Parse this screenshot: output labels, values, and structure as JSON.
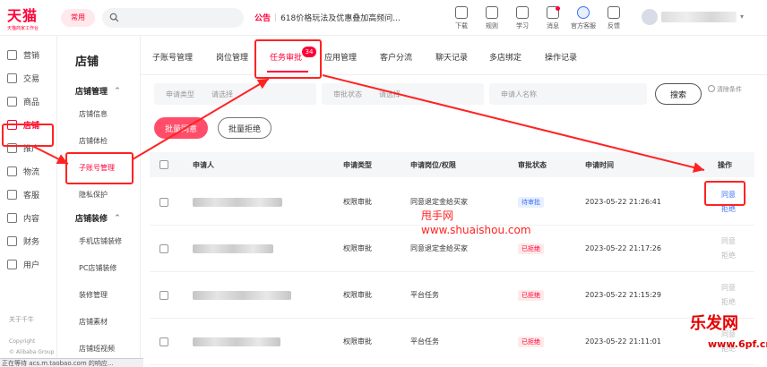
{
  "header": {
    "logo_main": "天猫",
    "logo_sub": "天猫商家工作台",
    "common_label": "常用",
    "notice_tag": "公告",
    "notice_text": "618价格玩法及优惠叠加高频问...",
    "icons": [
      {
        "label": "下载",
        "icon": "download-icon"
      },
      {
        "label": "规则",
        "icon": "rules-icon"
      },
      {
        "label": "学习",
        "icon": "learn-icon"
      },
      {
        "label": "消息",
        "icon": "message-icon",
        "dot": true
      },
      {
        "label": "官方客服",
        "icon": "service-icon"
      },
      {
        "label": "反馈",
        "icon": "feedback-icon"
      }
    ]
  },
  "leftnav": {
    "items": [
      {
        "label": "营销",
        "icon": "marketing-icon"
      },
      {
        "label": "交易",
        "icon": "trade-icon"
      },
      {
        "label": "商品",
        "icon": "goods-icon"
      },
      {
        "label": "店铺",
        "icon": "store-icon",
        "active": true
      },
      {
        "label": "推广",
        "icon": "promote-icon"
      },
      {
        "label": "物流",
        "icon": "logistics-icon"
      },
      {
        "label": "客服",
        "icon": "cs-icon"
      },
      {
        "label": "内容",
        "icon": "content-icon"
      },
      {
        "label": "财务",
        "icon": "finance-icon"
      },
      {
        "label": "用户",
        "icon": "user-icon"
      }
    ],
    "about": "关于千牛",
    "copyright": "Copyright",
    "copyright2": "© Alibaba Group"
  },
  "subnav": {
    "title": "店铺",
    "group1": "店铺管理",
    "group1_items": [
      "店铺信息",
      "店铺体检",
      "子账号管理",
      "隐私保护"
    ],
    "group2": "店铺装修",
    "group2_items": [
      "手机店铺装修",
      "PC店铺装修",
      "装修管理",
      "店铺素材",
      "店铺班视频"
    ]
  },
  "tabs": {
    "items": [
      "子账号管理",
      "岗位管理",
      "任务审批",
      "应用管理",
      "客户分流",
      "聊天记录",
      "多店绑定",
      "操作记录"
    ],
    "badge": "34"
  },
  "filters": {
    "type_label": "申请类型",
    "type_placeholder": "请选择",
    "status_label": "审批状态",
    "status_placeholder": "请选择",
    "applicant_placeholder": "申请人名称",
    "search": "搜索",
    "clear": "清除条件"
  },
  "actions": {
    "bulk_agree": "批量同意",
    "bulk_reject": "批量拒绝"
  },
  "table": {
    "headers": [
      "申请人",
      "申请类型",
      "申请岗位/权限",
      "审批状态",
      "申请时间",
      "操作"
    ],
    "rows": [
      {
        "type": "权限审批",
        "position": "同意退定金给买家",
        "status": "待审批",
        "status_kind": "pending",
        "time": "2023-05-22 21:26:41",
        "agree": "同意",
        "reject": "拒绝",
        "enabled": true
      },
      {
        "type": "权限审批",
        "position": "同意退定金给买家",
        "status": "已拒绝",
        "status_kind": "rejected",
        "time": "2023-05-22 21:17:26",
        "agree": "同意",
        "reject": "拒绝",
        "enabled": false
      },
      {
        "type": "权限审批",
        "position": "平台任务",
        "status": "已拒绝",
        "status_kind": "rejected",
        "time": "2023-05-22 21:15:29",
        "agree": "同意",
        "reject": "拒绝",
        "enabled": false
      },
      {
        "type": "权限审批",
        "position": "平台任务",
        "status": "已拒绝",
        "status_kind": "rejected",
        "time": "2023-05-22 21:11:01",
        "agree": "同意",
        "reject": "拒绝",
        "enabled": false
      }
    ]
  },
  "watermark": {
    "cn": "甩手网",
    "url": "www.shuaishou.com",
    "brand": "乐发网",
    "brand_url": "www.6pf.cn"
  },
  "browser_status": "正在等待 acs.m.taobao.com 的响应...",
  "colors": {
    "accent": "#ff0036",
    "link": "#3e6ff5",
    "annotation": "#ff2222"
  }
}
